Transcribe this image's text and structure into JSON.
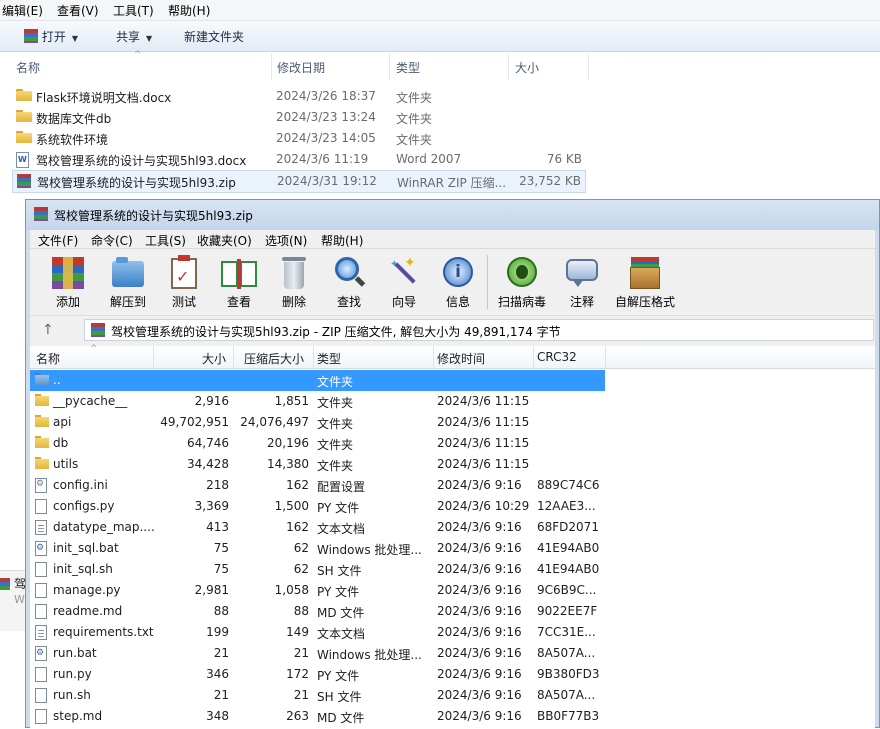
{
  "explorer": {
    "menu": [
      "编辑(E)",
      "查看(V)",
      "工具(T)",
      "帮助(H)"
    ],
    "toolbar": {
      "open": "打开",
      "share": "共享",
      "new_folder": "新建文件夹"
    },
    "columns": {
      "name": "名称",
      "date": "修改日期",
      "type": "类型",
      "size": "大小"
    },
    "rows": [
      {
        "name": "Flask环境说明文档.docx",
        "date": "2024/3/26 18:37",
        "type": "文件夹",
        "size": "",
        "icon": "folder-icon"
      },
      {
        "name": "数据库文件db",
        "date": "2024/3/23 13:24",
        "type": "文件夹",
        "size": "",
        "icon": "folder-icon"
      },
      {
        "name": "系统软件环境",
        "date": "2024/3/23 14:05",
        "type": "文件夹",
        "size": "",
        "icon": "folder-icon"
      },
      {
        "name": "驾校管理系统的设计与实现5hl93.docx",
        "date": "2024/3/6 11:19",
        "type": "Word 2007",
        "size": "76 KB",
        "icon": "word-doc-icon"
      },
      {
        "name": "驾校管理系统的设计与实现5hl93.zip",
        "date": "2024/3/31 19:12",
        "type": "WinRAR ZIP 压缩...",
        "size": "23,752 KB",
        "icon": "winrar-icon"
      }
    ],
    "peek_text": "驾",
    "peek_sub": "W"
  },
  "rar": {
    "title": "驾校管理系统的设计与实现5hl93.zip",
    "menu": [
      "文件(F)",
      "命令(C)",
      "工具(S)",
      "收藏夹(O)",
      "选项(N)",
      "帮助(H)"
    ],
    "tools": [
      "添加",
      "解压到",
      "测试",
      "查看",
      "删除",
      "查找",
      "向导",
      "信息",
      "扫描病毒",
      "注释",
      "自解压格式"
    ],
    "address": "驾校管理系统的设计与实现5hl93.zip - ZIP 压缩文件, 解包大小为 49,891,174 字节",
    "columns": {
      "name": "名称",
      "size": "大小",
      "packed": "压缩后大小",
      "type": "类型",
      "modified": "修改时间",
      "crc": "CRC32"
    },
    "rows": [
      {
        "name": "..",
        "size": "",
        "packed": "",
        "type": "文件夹",
        "modified": "",
        "crc": "",
        "icon": "up-folder-icon"
      },
      {
        "name": "__pycache__",
        "size": "2,916",
        "packed": "1,851",
        "type": "文件夹",
        "modified": "2024/3/6 11:15",
        "crc": "",
        "icon": "folder-icon"
      },
      {
        "name": "api",
        "size": "49,702,951",
        "packed": "24,076,497",
        "type": "文件夹",
        "modified": "2024/3/6 11:15",
        "crc": "",
        "icon": "folder-icon"
      },
      {
        "name": "db",
        "size": "64,746",
        "packed": "20,196",
        "type": "文件夹",
        "modified": "2024/3/6 11:15",
        "crc": "",
        "icon": "folder-icon"
      },
      {
        "name": "utils",
        "size": "34,428",
        "packed": "14,380",
        "type": "文件夹",
        "modified": "2024/3/6 11:15",
        "crc": "",
        "icon": "folder-icon"
      },
      {
        "name": "config.ini",
        "size": "218",
        "packed": "162",
        "type": "配置设置",
        "modified": "2024/3/6 9:16",
        "crc": "889C74C6",
        "icon": "config-file-icon"
      },
      {
        "name": "configs.py",
        "size": "3,369",
        "packed": "1,500",
        "type": "PY 文件",
        "modified": "2024/3/6 10:29",
        "crc": "12AAE3...",
        "icon": "file-icon"
      },
      {
        "name": "datatype_map....",
        "size": "413",
        "packed": "162",
        "type": "文本文档",
        "modified": "2024/3/6 9:16",
        "crc": "68FD2071",
        "icon": "text-file-icon"
      },
      {
        "name": "init_sql.bat",
        "size": "75",
        "packed": "62",
        "type": "Windows 批处理...",
        "modified": "2024/3/6 9:16",
        "crc": "41E94AB0",
        "icon": "batch-file-icon"
      },
      {
        "name": "init_sql.sh",
        "size": "75",
        "packed": "62",
        "type": "SH 文件",
        "modified": "2024/3/6 9:16",
        "crc": "41E94AB0",
        "icon": "file-icon"
      },
      {
        "name": "manage.py",
        "size": "2,981",
        "packed": "1,058",
        "type": "PY 文件",
        "modified": "2024/3/6 9:16",
        "crc": "9C6B9C...",
        "icon": "file-icon"
      },
      {
        "name": "readme.md",
        "size": "88",
        "packed": "88",
        "type": "MD 文件",
        "modified": "2024/3/6 9:16",
        "crc": "9022EE7F",
        "icon": "file-icon"
      },
      {
        "name": "requirements.txt",
        "size": "199",
        "packed": "149",
        "type": "文本文档",
        "modified": "2024/3/6 9:16",
        "crc": "7CC31E...",
        "icon": "text-file-icon"
      },
      {
        "name": "run.bat",
        "size": "21",
        "packed": "21",
        "type": "Windows 批处理...",
        "modified": "2024/3/6 9:16",
        "crc": "8A507A...",
        "icon": "batch-file-icon"
      },
      {
        "name": "run.py",
        "size": "346",
        "packed": "172",
        "type": "PY 文件",
        "modified": "2024/3/6 9:16",
        "crc": "9B380FD3",
        "icon": "file-icon"
      },
      {
        "name": "run.sh",
        "size": "21",
        "packed": "21",
        "type": "SH 文件",
        "modified": "2024/3/6 9:16",
        "crc": "8A507A...",
        "icon": "file-icon"
      },
      {
        "name": "step.md",
        "size": "348",
        "packed": "263",
        "type": "MD 文件",
        "modified": "2024/3/6 9:16",
        "crc": "BB0F77B3",
        "icon": "file-icon"
      }
    ]
  },
  "colors": {
    "selection": "#3399ff",
    "accent": "#cfdcec"
  }
}
